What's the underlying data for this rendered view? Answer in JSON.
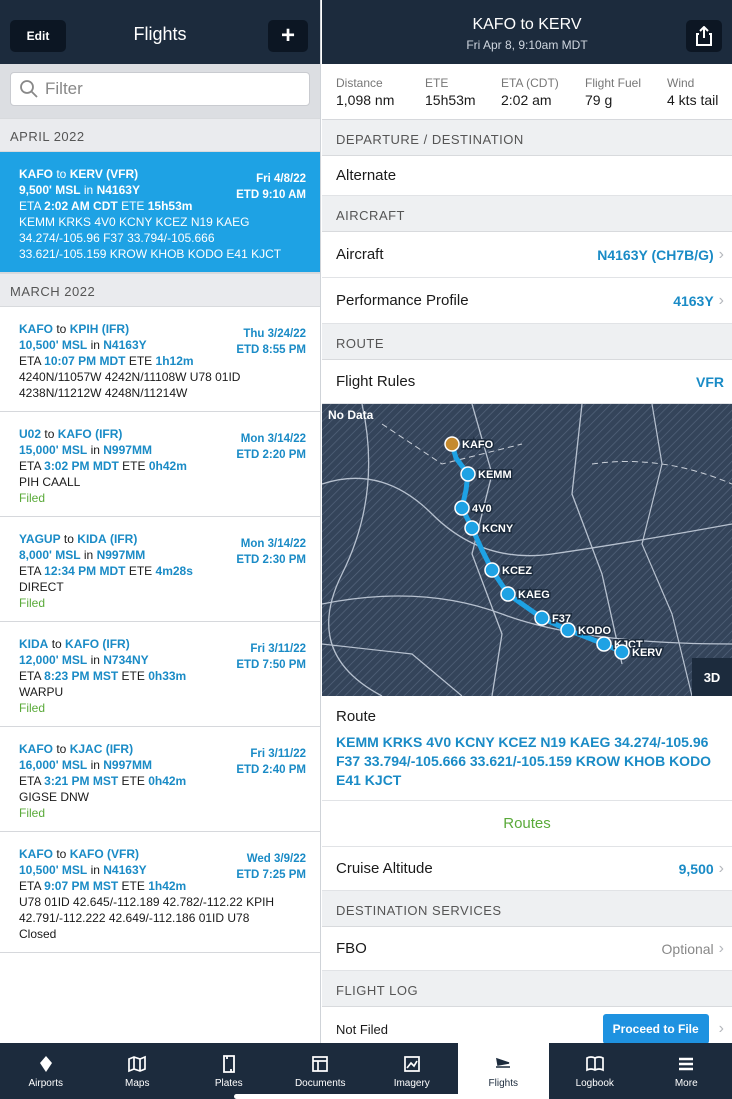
{
  "left": {
    "edit_label": "Edit",
    "title": "Flights",
    "filter_placeholder": "Filter",
    "sections": [
      {
        "header": "APRIL 2022"
      },
      {
        "header": "MARCH 2022"
      }
    ],
    "flights": [
      {
        "from": "KAFO",
        "to": "KERV",
        "rules": "VFR",
        "date": "Fri 4/8/22",
        "etd": "ETD 9:10 AM",
        "alt": "9,500' MSL",
        "aircraft": "N4163Y",
        "eta": "2:02 AM CDT",
        "ete": "15h53m",
        "route": "KEMM KRKS 4V0 KCNY KCEZ N19 KAEG 34.274/-105.96 F37 33.794/-105.666 33.621/-105.159 KROW KHOB KODO E41 KJCT",
        "status": ""
      },
      {
        "from": "KAFO",
        "to": "KPIH",
        "rules": "IFR",
        "date": "Thu 3/24/22",
        "etd": "ETD 8:55 PM",
        "alt": "10,500' MSL",
        "aircraft": "N4163Y",
        "eta": "10:07 PM MDT",
        "ete": "1h12m",
        "route": "4240N/11057W 4242N/11108W U78 01ID 4238N/11212W 4248N/11214W",
        "status": ""
      },
      {
        "from": "U02",
        "to": "KAFO",
        "rules": "IFR",
        "date": "Mon 3/14/22",
        "etd": "ETD 2:20 PM",
        "alt": "15,000' MSL",
        "aircraft": "N997MM",
        "eta": "3:02 PM MDT",
        "ete": "0h42m",
        "route": "PIH CAALL",
        "status": "Filed"
      },
      {
        "from": "YAGUP",
        "to": "KIDA",
        "rules": "IFR",
        "date": "Mon 3/14/22",
        "etd": "ETD 2:30 PM",
        "alt": "8,000' MSL",
        "aircraft": "N997MM",
        "eta": "12:34 PM MDT",
        "ete": "4m28s",
        "route": "DIRECT",
        "status": "Filed"
      },
      {
        "from": "KIDA",
        "to": "KAFO",
        "rules": "IFR",
        "date": "Fri 3/11/22",
        "etd": "ETD 7:50 PM",
        "alt": "12,000' MSL",
        "aircraft": "N734NY",
        "eta": "8:23 PM MST",
        "ete": "0h33m",
        "route": "WARPU",
        "status": "Filed"
      },
      {
        "from": "KAFO",
        "to": "KJAC",
        "rules": "IFR",
        "date": "Fri 3/11/22",
        "etd": "ETD 2:40 PM",
        "alt": "16,000' MSL",
        "aircraft": "N997MM",
        "eta": "3:21 PM MST",
        "ete": "0h42m",
        "route": "GIGSE DNW",
        "status": "Filed"
      },
      {
        "from": "KAFO",
        "to": "KAFO",
        "rules": "VFR",
        "date": "Wed 3/9/22",
        "etd": "ETD 7:25 PM",
        "alt": "10,500' MSL",
        "aircraft": "N4163Y",
        "eta": "9:07 PM MST",
        "ete": "1h42m",
        "route": "U78 01ID 42.645/-112.189 42.782/-112.22 KPIH 42.791/-112.222 42.649/-112.186 01ID U78",
        "status": "Closed"
      }
    ],
    "words": {
      "to": "to",
      "in": "in",
      "eta": "ETA",
      "ete": "ETE"
    }
  },
  "right": {
    "title": "KAFO to KERV",
    "subtitle": "Fri Apr 8, 9:10am MDT",
    "stats": [
      {
        "key": "Distance",
        "value": "1,098 nm"
      },
      {
        "key": "ETE",
        "value": "15h53m"
      },
      {
        "key": "ETA (CDT)",
        "value": "2:02 am"
      },
      {
        "key": "Flight Fuel",
        "value": "79 g"
      },
      {
        "key": "Wind",
        "value": "4 kts tail"
      }
    ],
    "sec_departure": "DEPARTURE / DESTINATION",
    "alternate_label": "Alternate",
    "sec_aircraft": "AIRCRAFT",
    "aircraft_label": "Aircraft",
    "aircraft_value": "N4163Y (CH7B/G)",
    "perf_label": "Performance Profile",
    "perf_value": "4163Y",
    "sec_route": "ROUTE",
    "rules_label": "Flight Rules",
    "rules_value": "VFR",
    "map": {
      "no_data": "No Data",
      "btn_3d": "3D",
      "waypoints": [
        "KAFO",
        "KEMM",
        "4V0",
        "KCNY",
        "KCEZ",
        "KAEG",
        "F37",
        "KODO",
        "KJCT",
        "KERV"
      ]
    },
    "route_label": "Route",
    "route_text": "KEMM KRKS 4V0 KCNY KCEZ N19 KAEG 34.274/-105.96 F37 33.794/-105.666 33.621/-105.159 KROW KHOB KODO E41 KJCT",
    "routes_link": "Routes",
    "cruise_label": "Cruise Altitude",
    "cruise_value": "9,500",
    "sec_dest_services": "DESTINATION SERVICES",
    "fbo_label": "FBO",
    "fbo_value": "Optional",
    "sec_flight_log": "FLIGHT LOG",
    "not_filed": "Not Filed",
    "proceed_label": "Proceed to File"
  },
  "tabbar": [
    {
      "label": "Airports",
      "icon": "airports-icon"
    },
    {
      "label": "Maps",
      "icon": "map-icon"
    },
    {
      "label": "Plates",
      "icon": "plates-icon"
    },
    {
      "label": "Documents",
      "icon": "documents-icon"
    },
    {
      "label": "Imagery",
      "icon": "imagery-icon"
    },
    {
      "label": "Flights",
      "icon": "flights-icon",
      "active": true
    },
    {
      "label": "Logbook",
      "icon": "logbook-icon"
    },
    {
      "label": "More",
      "icon": "menu-icon"
    }
  ],
  "colors": {
    "navy": "#1c2b3d",
    "accent": "#1a8bc6",
    "selected": "#1ea2e4",
    "green": "#5aaa3a"
  }
}
